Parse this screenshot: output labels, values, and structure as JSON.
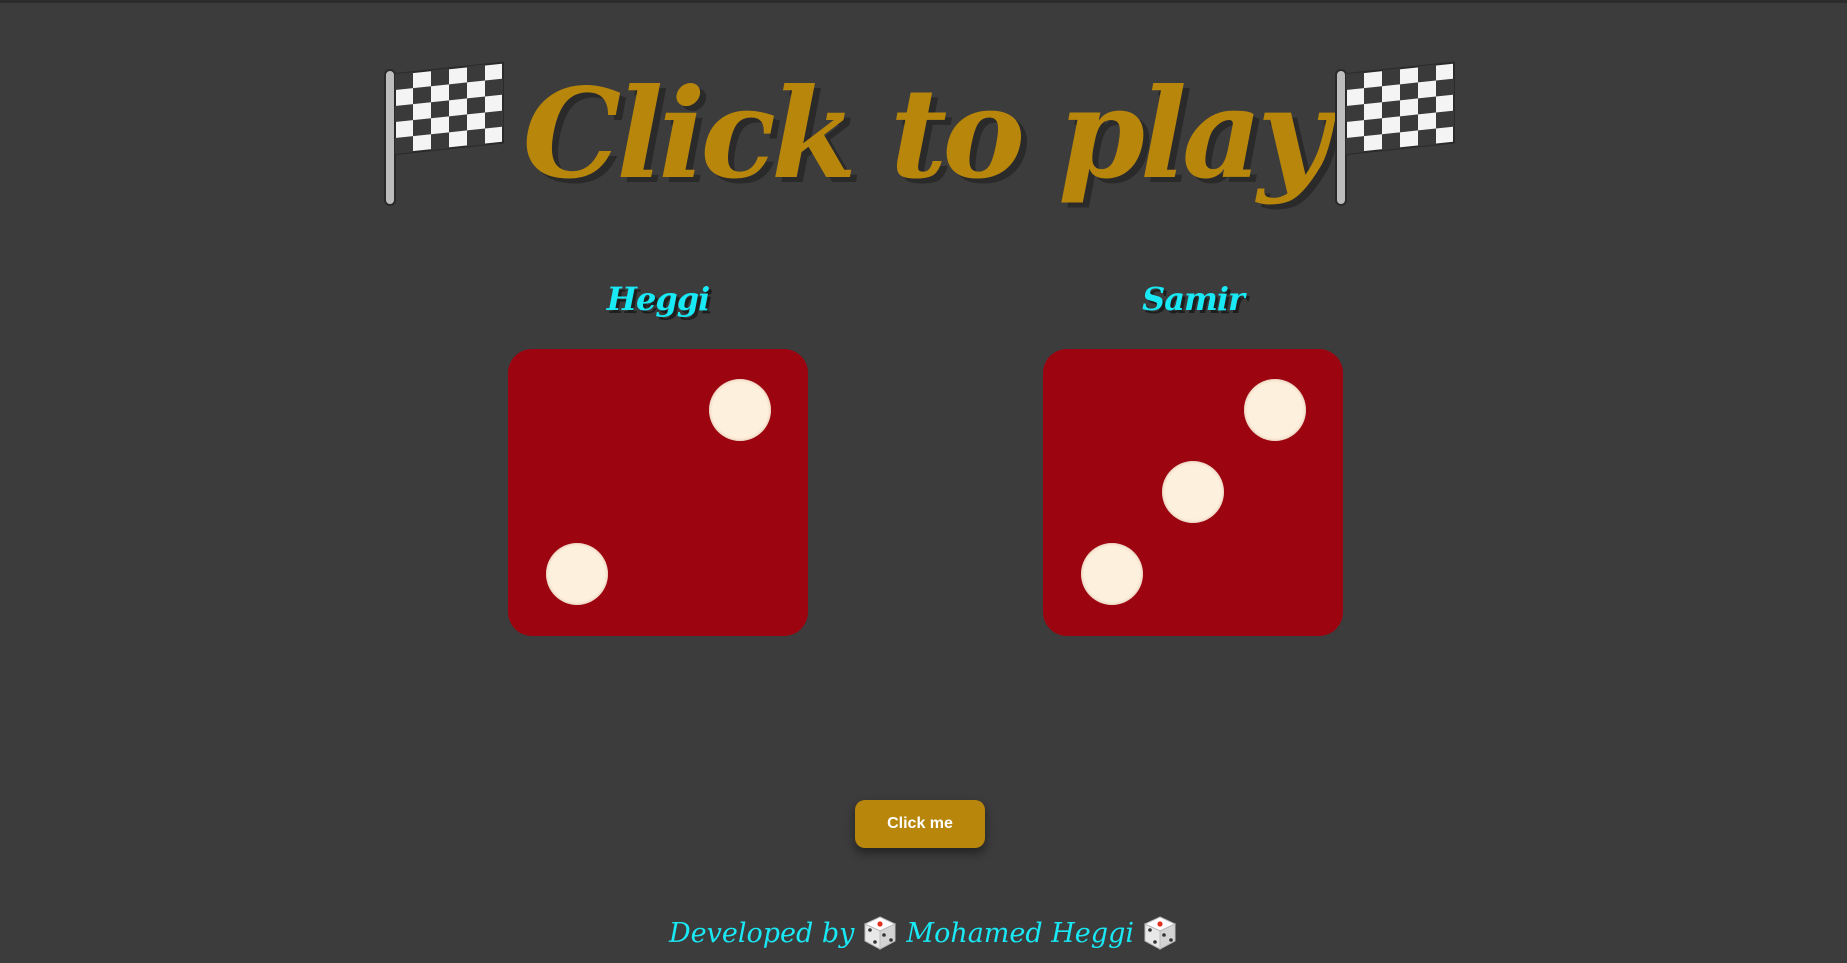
{
  "title": {
    "text": "Click to play",
    "left_icon": "checkered-flag-icon",
    "right_icon": "checkered-flag-icon"
  },
  "players": [
    {
      "name": "Heggi",
      "die_value": 2
    },
    {
      "name": "Samir",
      "die_value": 3
    }
  ],
  "button": {
    "label": "Click me"
  },
  "footer": {
    "prefix": "Developed by",
    "author": "Mohamed Heggi",
    "icon": "game-die-icon"
  },
  "colors": {
    "background": "#3c3c3c",
    "title": "#b8860b",
    "player_name": "#19e8f5",
    "die": "#9c0510",
    "pip": "#fdf0dc",
    "button": "#b8860b"
  }
}
